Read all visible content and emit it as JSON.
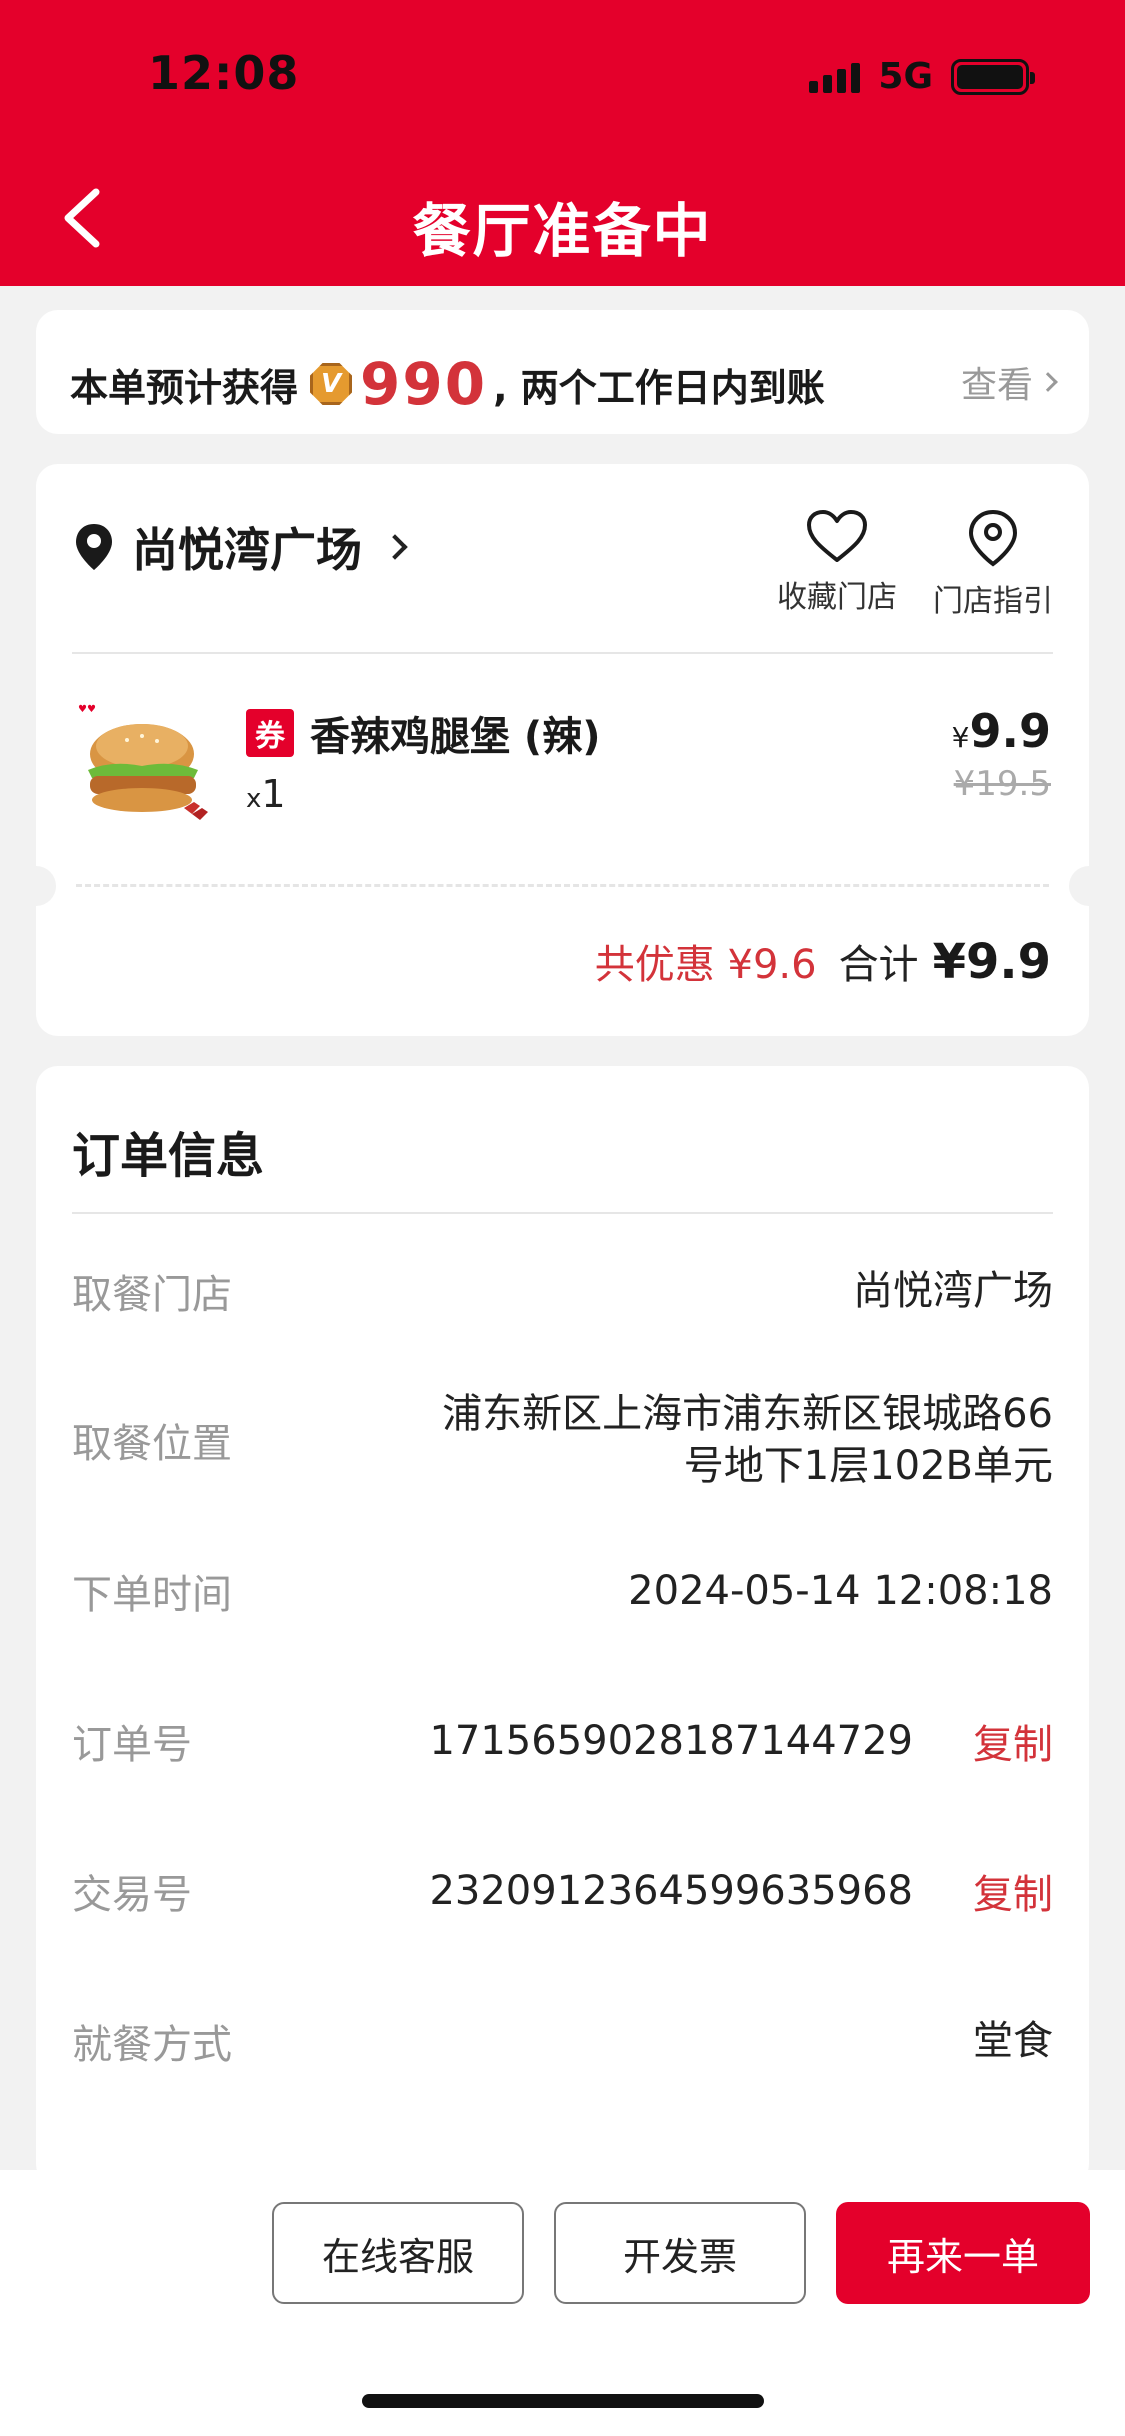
{
  "status_bar": {
    "time": "12:08",
    "network": "5G"
  },
  "header": {
    "title": "餐厅准备中"
  },
  "points": {
    "prefix": "本单预计获得",
    "value": "990",
    "suffix": ", 两个工作日内到账",
    "view_label": "查看"
  },
  "store": {
    "name": "尚悦湾广场",
    "favorite_label": "收藏门店",
    "guide_label": "门店指引"
  },
  "product": {
    "coupon_tag": "券",
    "name": "香辣鸡腿堡 (辣)",
    "qty_prefix": "x",
    "qty": "1",
    "currency": "¥",
    "price": "9.9",
    "original_price": "¥19.5"
  },
  "totals": {
    "discount_label": "共优惠",
    "discount_value": "¥9.6",
    "total_label": "合计",
    "total_value": "¥9.9"
  },
  "order_info": {
    "title": "订单信息",
    "rows": [
      {
        "label": "取餐门店",
        "value": "尚悦湾广场"
      },
      {
        "label": "取餐位置",
        "value": "浦东新区上海市浦东新区银城路66号地下1层102B单元"
      },
      {
        "label": "下单时间",
        "value": "2024-05-14 12:08:18"
      },
      {
        "label": "订单号",
        "value": "1715659028187144729",
        "action": "复制"
      },
      {
        "label": "交易号",
        "value": "2320912364599635968",
        "action": "复制"
      },
      {
        "label": "就餐方式",
        "value": "堂食"
      }
    ]
  },
  "actions": {
    "service": "在线客服",
    "invoice": "开发票",
    "reorder": "再来一单"
  },
  "colors": {
    "brand": "#e4002b",
    "accent_text": "#d3333a"
  }
}
